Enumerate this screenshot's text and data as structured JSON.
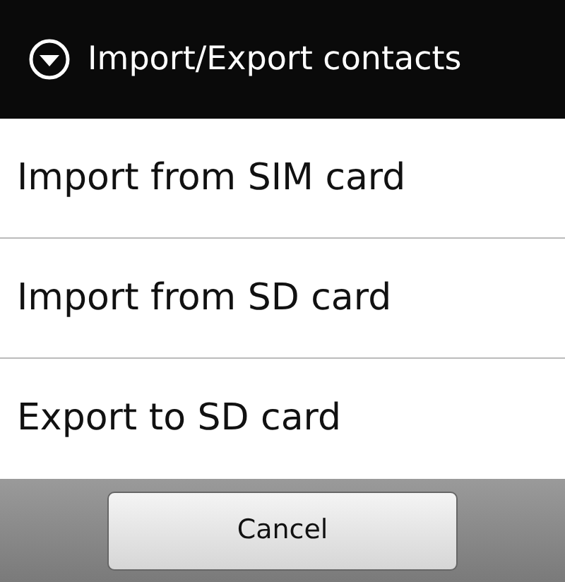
{
  "dialog": {
    "title": "Import/Export contacts"
  },
  "options": [
    {
      "label": "Import from SIM card"
    },
    {
      "label": "Import from SD card"
    },
    {
      "label": "Export to SD card"
    }
  ],
  "buttons": [
    {
      "label": "Cancel"
    }
  ]
}
